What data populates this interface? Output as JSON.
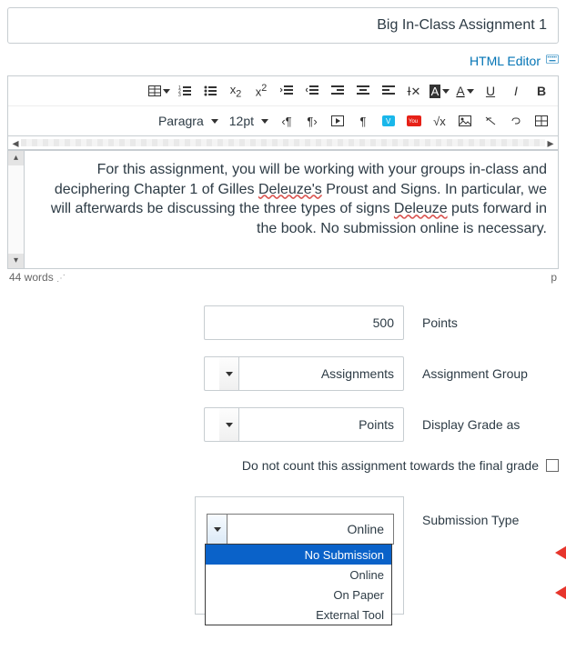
{
  "title_value": "Big In-Class Assignment 1",
  "html_editor_label": "HTML Editor",
  "editor_text_line1": "For this assignment, you will be working with your groups in-class and",
  "editor_text_line2_a": "deciphering Chapter 1 of Gilles ",
  "editor_text_line2_sp1": "Deleuze's",
  "editor_text_line2_b": " Proust and Signs. In particular, we",
  "editor_text_line3_a": "will afterwards be discussing the three types of signs ",
  "editor_text_line3_sp": "Deleuze",
  "editor_text_line3_b": " puts forward in",
  "editor_text_line4": "the book. No submission online is necessary.",
  "status_tag": "p",
  "status_words": "44 words",
  "toolbar_row1": [
    "bold",
    "italic",
    "underline",
    "font-color",
    "bg-color",
    "clear-format",
    "align-left",
    "align-center",
    "align-right",
    "outdent",
    "indent",
    "superscript",
    "subscript",
    "bullet-list",
    "number-list",
    "table-icon"
  ],
  "toolbar_row2": [
    "table-grid",
    "link",
    "unlink",
    "image",
    "embed-youtube",
    "embed-vimeo",
    "pi",
    "equation",
    "record",
    "ltr",
    "rtl",
    "keyboard",
    "fullscreen"
  ],
  "font_size": "12pt",
  "font_family": "Paragra",
  "labels": {
    "points": "Points",
    "assignment_group": "Assignment Group",
    "display_grade_as": "Display Grade as",
    "dont_count": "Do not count this assignment towards the final grade",
    "submission_type": "Submission Type"
  },
  "values": {
    "points": "500",
    "assignment_group": "Assignments",
    "display_grade_as": "Points",
    "submission_selected": "Online"
  },
  "dropdown_options": [
    "No Submission",
    "Online",
    "On Paper",
    "External Tool"
  ],
  "dropdown_selected_index": 0,
  "icons": {
    "bold": "B",
    "italic": "I",
    "underline": "U",
    "super": "x²",
    "sub": "x₂"
  }
}
